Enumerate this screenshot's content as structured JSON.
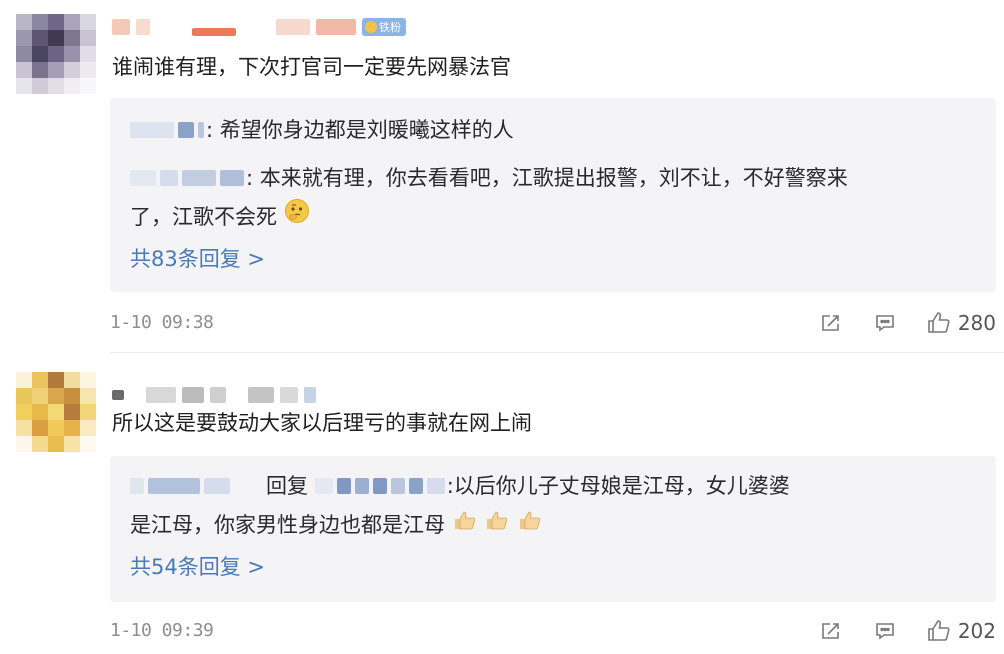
{
  "comments": [
    {
      "badge": "铁粉",
      "text": "谁闹谁有理，下次打官司一定要先网暴法官",
      "replies": [
        {
          "text": ": 希望你身边都是刘暖曦这样的人"
        },
        {
          "text": ": 本来就有理，你去看看吧，江歌提出报警，刘不让，不好警察来",
          "text2": "了，江歌不会死"
        }
      ],
      "more_replies": "共83条回复 >",
      "time": "1-10 09:38",
      "likes": "280"
    },
    {
      "text": "所以这是要鼓动大家以后理亏的事就在网上闹",
      "replies": [
        {
          "reply_word": "回复",
          "text": ":以后你儿子丈母娘是江母，女儿婆婆",
          "text2": "是江母，你家男性身边也都是江母"
        }
      ],
      "more_replies": "共54条回复 >",
      "time": "1-10 09:39",
      "likes": "202"
    }
  ],
  "icons": {
    "share": "share-icon",
    "comment": "comment-icon",
    "like": "thumbs-up-icon"
  },
  "colors": {
    "link": "#4a79b5",
    "reply_bg": "#f4f4f6",
    "badge": "#8ab3e6",
    "meta_text": "#8e8e8e"
  }
}
